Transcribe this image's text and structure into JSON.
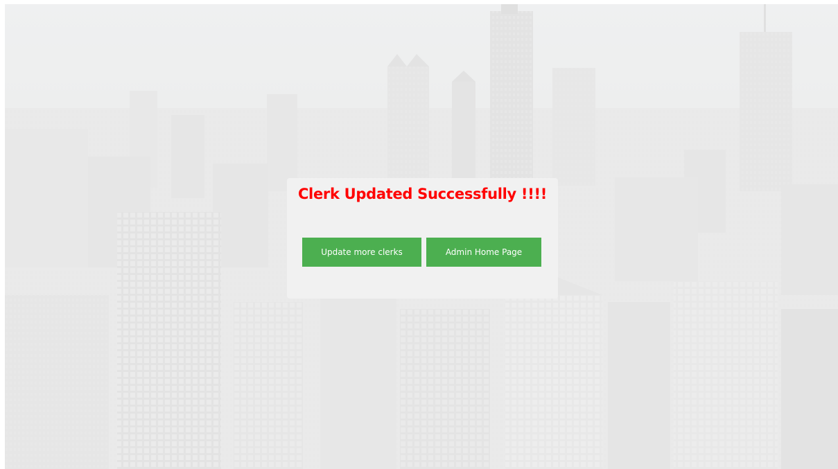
{
  "message": {
    "title": "Clerk Updated Successfully !!!!"
  },
  "buttons": {
    "update_more_clerks": "Update more clerks",
    "admin_home_page": "Admin Home Page"
  },
  "colors": {
    "title": "#ff0000",
    "button_background": "#4caf50",
    "button_text": "#ffffff",
    "card_background": "#f1f1f1"
  }
}
